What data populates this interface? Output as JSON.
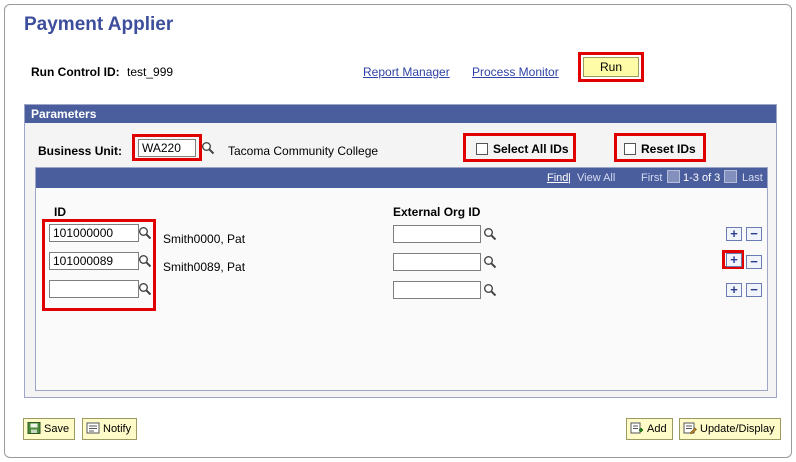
{
  "page": {
    "title": "Payment Applier",
    "run_control_label": "Run Control ID:",
    "run_control_value": "test_999",
    "report_manager": "Report Manager",
    "process_monitor": "Process Monitor",
    "run": "Run"
  },
  "parameters": {
    "header": "Parameters",
    "business_unit_label": "Business Unit:",
    "business_unit_value": "WA220",
    "business_unit_desc": "Tacoma Community College",
    "select_all_ids": "Select All IDs",
    "reset_ids": "Reset IDs"
  },
  "grid": {
    "find": "Find",
    "separator": "|",
    "view_all": "View All",
    "first": "First",
    "range": "1-3 of 3",
    "last": "Last",
    "col_id": "ID",
    "col_ext": "External Org ID",
    "rows": [
      {
        "id": "101000000",
        "name": "Smith0000, Pat",
        "ext": ""
      },
      {
        "id": "101000089",
        "name": "Smith0089, Pat",
        "ext": ""
      },
      {
        "id": "",
        "name": "",
        "ext": ""
      }
    ],
    "plus": "+",
    "minus": "−"
  },
  "footer": {
    "save": "Save",
    "notify": "Notify",
    "add": "Add",
    "update_display": "Update/Display"
  },
  "colors": {
    "title": "#3d4f9c",
    "header_bg": "#4a5e9e",
    "highlight": "#e10000",
    "button_bg": "#fffbc9"
  }
}
